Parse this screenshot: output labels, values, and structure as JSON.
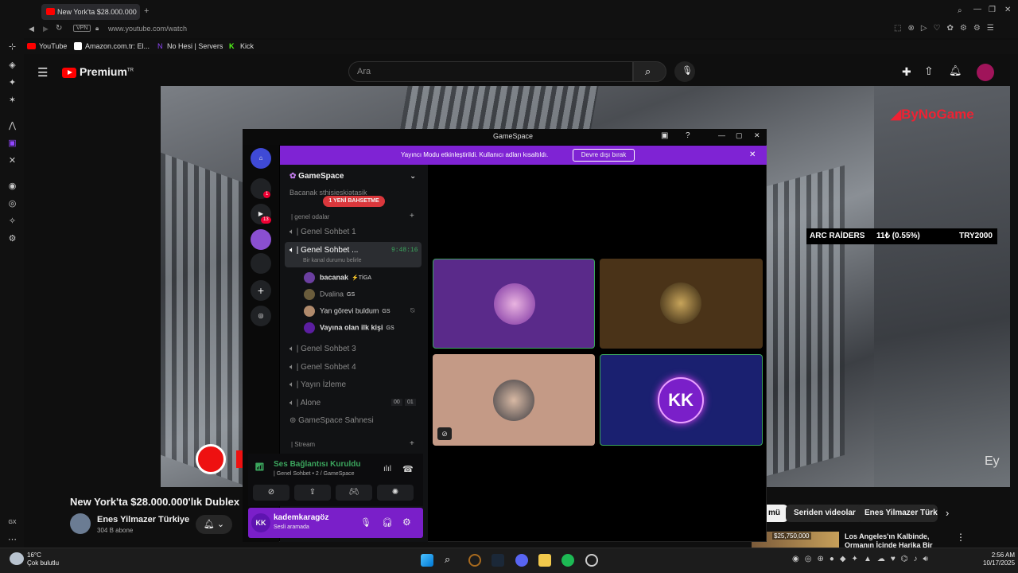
{
  "browser": {
    "tab_title": "New York'ta $28.000.000",
    "vpn": "VPN",
    "url": "www.youtube.com/watch",
    "bookmarks": [
      "YouTube",
      "Amazon.com.tr: El...",
      "No Hesi | Servers",
      "Kick"
    ]
  },
  "youtube": {
    "logo": "Premium",
    "logo_sup": "TR",
    "search_placeholder": "Ara",
    "video_title": "New York'ta $28.000.000'lık Dublex D",
    "channel": "Enes Yilmazer Türkiye",
    "subscribers": "304 B abone",
    "chips": [
      "mü",
      "Seriden videolar",
      "Enes Yilmazer Türkiye"
    ],
    "next_video_title": "Los Angeles'ın Kalbinde, Ormanın İçinde Harika Bir",
    "next_video_price": "$25,750,000",
    "overlay_brand": "ByNoGame",
    "ticker": {
      "name": "ARC RAİDERS",
      "price": "11₺ (0.55%)",
      "pair": "TRY2000"
    },
    "watermark": "Ey"
  },
  "gamespace": {
    "window_title": "GameSpace",
    "banner_text": "Yayıncı Modu etkinleştirildi. Kullanıcı adları kısaltıldı.",
    "banner_button": "Devre dışı bırak",
    "server_name": "GameSpace",
    "top_channel": "Bacanak sthisieskiətasik",
    "new_mention": "1 YENİ BAHSETME",
    "category1": "| genel odalar",
    "channels": [
      {
        "name": "| Genel Sohbet",
        "suffix": "1"
      },
      {
        "name": "| Genel Sohbet ...",
        "timer": "9:48:16",
        "status": "Bir kanal durumu belirle"
      },
      {
        "name": "| Genel Sohbet",
        "suffix": "3"
      },
      {
        "name": "| Genel Sohbet",
        "suffix": "4"
      },
      {
        "name": "| Yayın İzleme"
      },
      {
        "name": "| Alone",
        "counts": [
          "00",
          "01"
        ]
      },
      {
        "name": "GameSpace Sahnesi"
      }
    ],
    "users": [
      {
        "name": "bacanak",
        "tag": "⚡TİGA"
      },
      {
        "name": "Dvalina",
        "tag": "GS"
      },
      {
        "name": "Yan görevi buldum",
        "tag": "GS"
      },
      {
        "name": "Vayına olan ilk kişi",
        "tag": "GS"
      }
    ],
    "category2": "| Stream",
    "voice_status": "Ses Bağlantısı Kuruldu",
    "voice_channel": "| Genel Sohbet  •  2 / GameSpace",
    "username": "kademkaragöz",
    "user_status": "Sesli aramada",
    "server_badges": [
      "1",
      "13"
    ],
    "tile_initials": "KK"
  },
  "taskbar": {
    "temp": "16°C",
    "weather": "Çok bulutlu",
    "time": "2:56 AM",
    "date": "10/17/2025",
    "gx": "GX"
  }
}
